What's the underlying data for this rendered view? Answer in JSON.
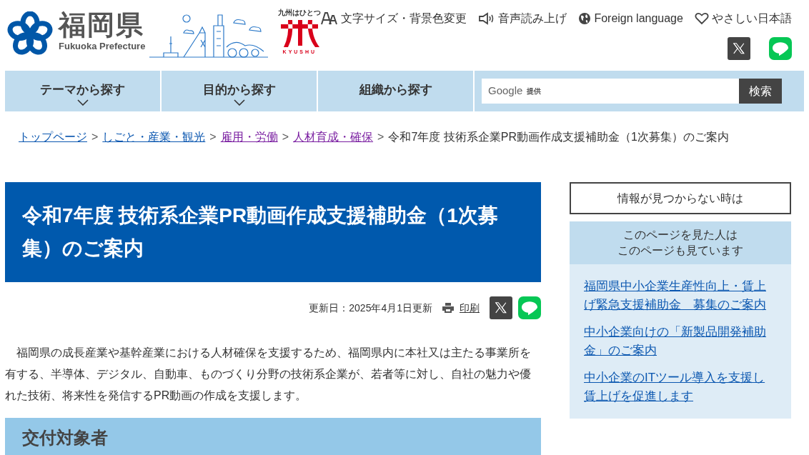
{
  "header": {
    "logo_title": "福岡県",
    "logo_subtitle": "Fukuoka Prefecture",
    "kyushu_tagline": "九州はひとつ",
    "kyushu_label": "KYUSHU",
    "utility_links": [
      {
        "kind": "font",
        "label": "文字サイズ・背景色変更"
      },
      {
        "kind": "speaker",
        "label": "音声読み上げ"
      },
      {
        "kind": "globe",
        "label": "Foreign language"
      },
      {
        "kind": "heart",
        "label": "やさしい日本語"
      }
    ],
    "social": [
      {
        "kind": "x"
      },
      {
        "kind": "line"
      }
    ]
  },
  "nav": {
    "items": [
      {
        "label": "テーマから探す",
        "expandable": true
      },
      {
        "label": "目的から探す",
        "expandable": true
      },
      {
        "label": "組織から探す",
        "expandable": false
      }
    ],
    "search": {
      "brand": "Google",
      "brand_suffix": "提供",
      "button": "検索"
    }
  },
  "breadcrumb": {
    "links": [
      {
        "label": "トップページ",
        "visited": false
      },
      {
        "label": "しごと・産業・観光",
        "visited": false
      },
      {
        "label": "雇用・労働",
        "visited": true
      },
      {
        "label": "人材育成・確保",
        "visited": true
      }
    ],
    "separator": ">",
    "current": "令和7年度 技術系企業PR動画作成支援補助金（1次募集）のご案内"
  },
  "article": {
    "title": "令和7年度 技術系企業PR動画作成支援補助金（1次募集）のご案内",
    "updated": "更新日：2025年4月1日更新",
    "print": "印刷",
    "share": [
      {
        "kind": "x"
      },
      {
        "kind": "line"
      }
    ],
    "intro": "福岡県の成長産業や基幹産業における人材確保を支援するため、福岡県内に本社又は主たる事業所を有する、半導体、デジタル、自動車、ものづくり分野の技術系企業が、若者等に対し、自社の魅力や優れた技術、将来性を発信するPR動画の作成を支援します。",
    "section_heading": "交付対象者"
  },
  "sidebar": {
    "help_button": "情報が見つからない時は",
    "related": {
      "heading": [
        "このページを見た人は",
        "このページも見ています"
      ],
      "links": [
        "福岡県中小企業生産性向上・賃上げ緊急支援補助金　募集のご案内",
        "中小企業向けの「新製品開発補助金」のご案内",
        "中小企業のITツール導入を支援し賃上げを促進します"
      ]
    }
  }
}
